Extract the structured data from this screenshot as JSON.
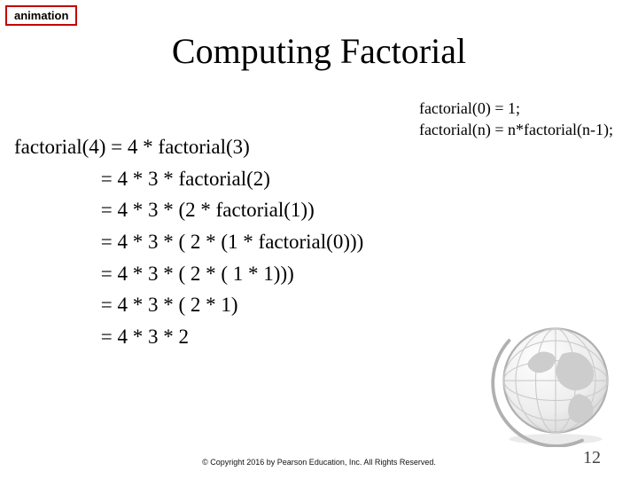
{
  "badge": {
    "label": "animation"
  },
  "title": "Computing Factorial",
  "rules": {
    "line1": "factorial(0) = 1;",
    "line2": "factorial(n) = n*factorial(n-1);"
  },
  "expansion": {
    "lines": [
      "factorial(4) = 4 * factorial(3)",
      "                 = 4 * 3 * factorial(2)",
      "                 = 4 * 3 * (2 * factorial(1))",
      "                 = 4 * 3 * ( 2 * (1 * factorial(0)))",
      "                 = 4 * 3 * ( 2 * ( 1 * 1)))",
      "                 = 4 * 3 * ( 2 * 1)",
      "                 = 4 * 3 * 2"
    ]
  },
  "footer": "© Copyright 2016 by Pearson Education, Inc. All Rights Reserved.",
  "page_number": "12"
}
